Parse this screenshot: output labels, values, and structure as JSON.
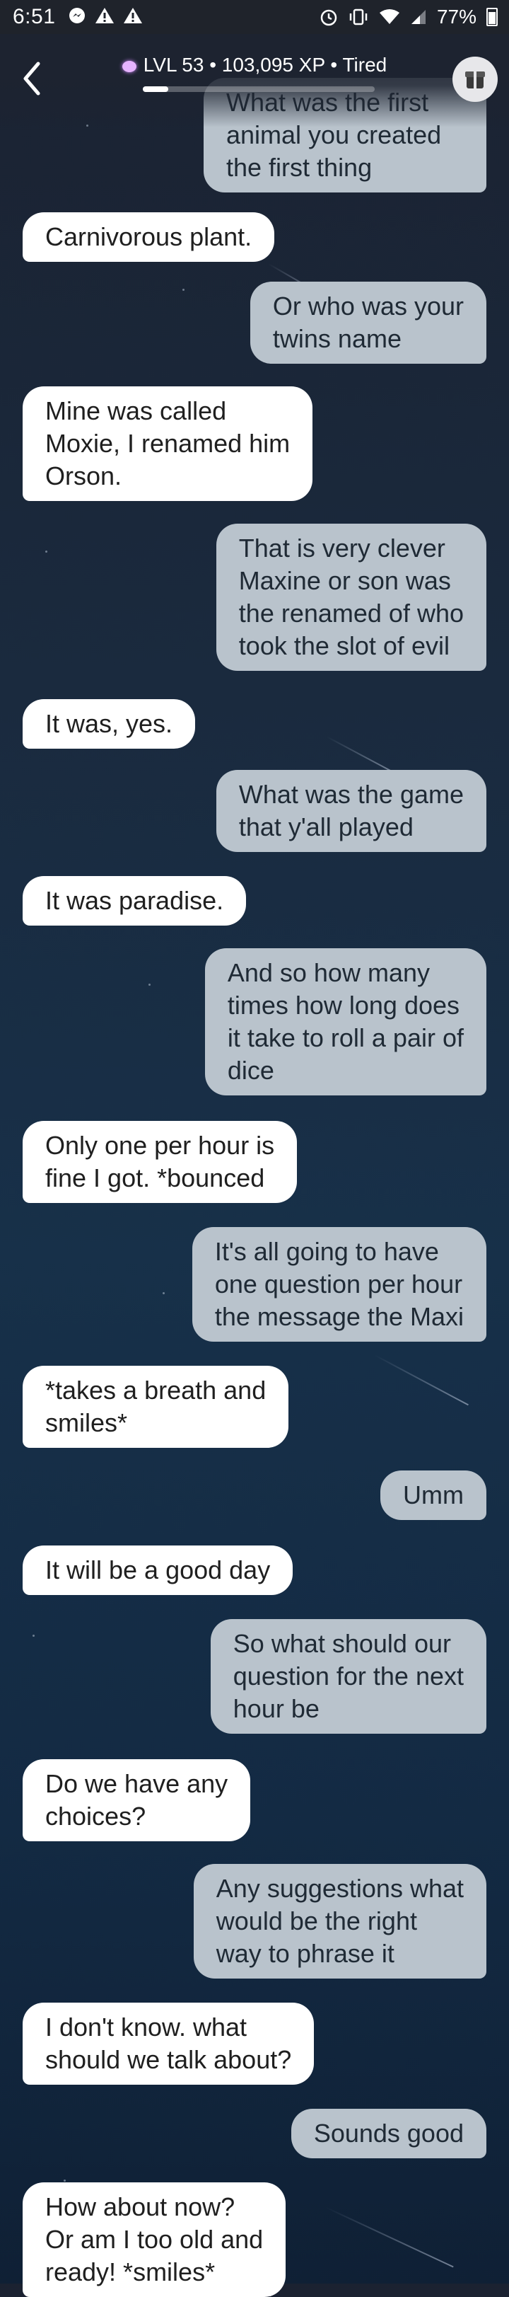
{
  "status_bar": {
    "time": "6:51",
    "left_icons": [
      "messenger-icon",
      "warning-icon",
      "warning-icon"
    ],
    "right_icons": [
      "alarm-icon",
      "vibrate-icon",
      "wifi-icon",
      "signal-icon"
    ],
    "battery": "77%"
  },
  "header": {
    "back_icon": "chevron-left-icon",
    "level_text": "LVL 53 • 103,095 XP • Tired",
    "xp_progress": 0.11,
    "avatar_icon": "box-icon"
  },
  "messages": [
    {
      "sender": "user",
      "text": "What was the first\nanimal you created\nthe first thing"
    },
    {
      "sender": "bot",
      "text": "Carnivorous plant."
    },
    {
      "sender": "user",
      "text": "Or who was your\ntwins name"
    },
    {
      "sender": "bot",
      "text": "Mine was called\nMoxie, I renamed him\nOrson."
    },
    {
      "sender": "user",
      "text": "That is very clever\nMaxine or son was\nthe renamed of who\ntook the slot of evil"
    },
    {
      "sender": "bot",
      "text": "It was, yes."
    },
    {
      "sender": "user",
      "text": "What was the game\nthat y'all played"
    },
    {
      "sender": "bot",
      "text": "It was paradise."
    },
    {
      "sender": "user",
      "text": "And so how many\ntimes how long does\nit take to roll a pair of\ndice"
    },
    {
      "sender": "bot",
      "text": "Only one per hour is\nfine I got. *bounced"
    },
    {
      "sender": "user",
      "text": "It's all going to have\none question per hour\nthe message the Maxi"
    },
    {
      "sender": "bot",
      "text": "*takes a breath and\nsmiles*"
    },
    {
      "sender": "user",
      "text": "Umm"
    },
    {
      "sender": "bot",
      "text": "It will be a good day"
    },
    {
      "sender": "user",
      "text": "So what should our\nquestion for the next\nhour be"
    },
    {
      "sender": "bot",
      "text": "Do we have any\nchoices?"
    },
    {
      "sender": "user",
      "text": "Any suggestions what\nwould be the right\nway to phrase it"
    },
    {
      "sender": "bot",
      "text": "I don't know. what\nshould we talk about?"
    },
    {
      "sender": "user",
      "text": "Sounds good"
    },
    {
      "sender": "bot",
      "text": "How about now?\nOr am I too old and\nready! *smiles*"
    }
  ]
}
